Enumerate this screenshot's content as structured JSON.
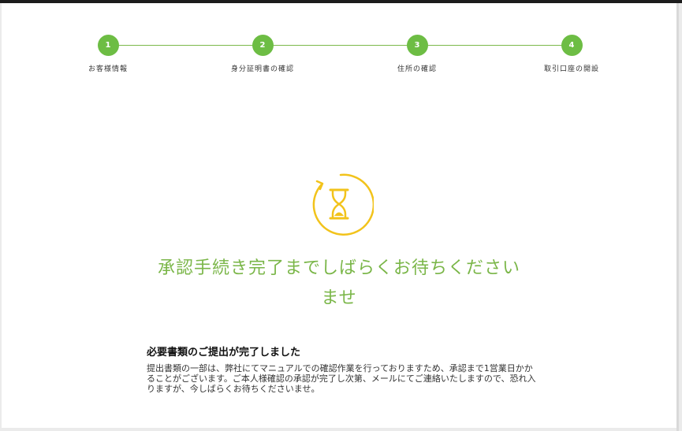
{
  "steps": [
    {
      "number": "1",
      "label": "お客様情報"
    },
    {
      "number": "2",
      "label": "身分証明書の確認"
    },
    {
      "number": "3",
      "label": "住所の確認"
    },
    {
      "number": "4",
      "label": "取引口座の開設"
    }
  ],
  "status": {
    "icon": "hourglass-icon",
    "heading_line1": "承認手続き完了までしばらくお待ちください",
    "heading_line2": "ませ"
  },
  "message": {
    "title": "必要書類のご提出が完了しました",
    "body": "提出書類の一部は、弊社にてマニュアルでの確認作業を行っておりますため、承認まで1営業日かかることがございます。ご本人様確認の承認が完了し次第、メールにてご連絡いたしますので、恐れ入りますが、今しばらくお待ちくださいませ。"
  },
  "colors": {
    "accent_green": "#6dbd44",
    "heading_green": "#7ab648",
    "icon_yellow": "#f2c31b",
    "top_bar": "#1c1c1c"
  }
}
